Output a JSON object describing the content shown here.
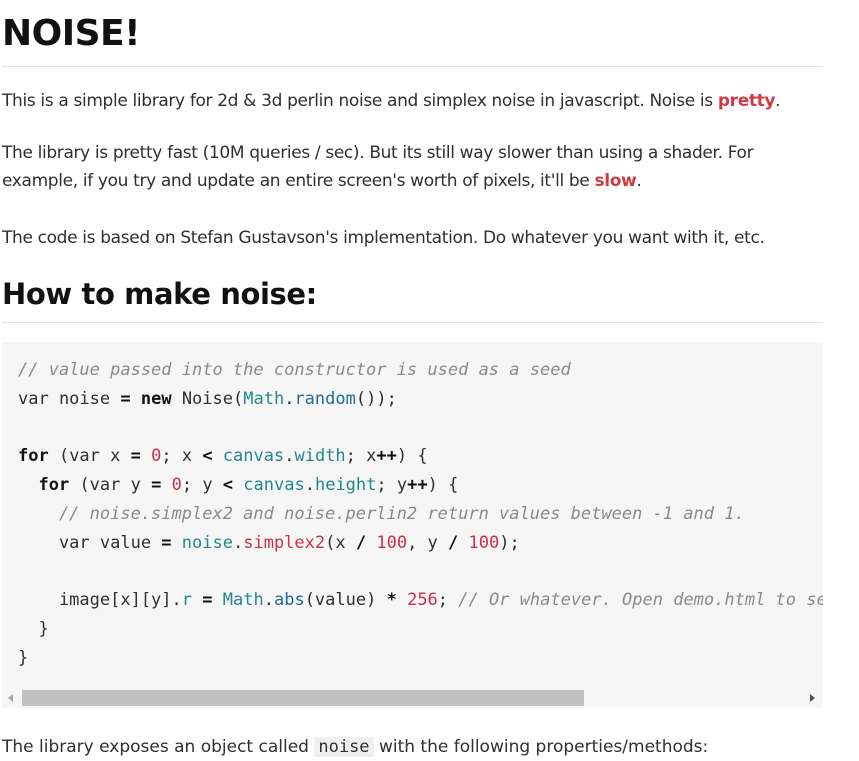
{
  "page": {
    "title": "NOISE!",
    "intro": {
      "text": "This is a simple library for 2d & 3d perlin noise and simplex noise in javascript. Noise is ",
      "highlight": "pretty",
      "end": "."
    },
    "speed": {
      "line1": "The library is pretty fast (10M queries / sec). But its still way slower than using a shader. For",
      "line2": "example, if you try and update an entire screen's worth of pixels, it'll be ",
      "highlight": "slow",
      "end": "."
    },
    "credit": "The code is based on Stefan Gustavson's implementation. Do whatever you want with it, etc.",
    "section_heading": "How to make noise:",
    "bottom_partial": {
      "before": "The library exposes an object called ",
      "code": "noise",
      "after": " with the following properties/methods:"
    }
  },
  "code": {
    "l1": "// value passed into the constructor is used as a seed",
    "l2": {
      "a": "var noise ",
      "eq": "=",
      "b": " ",
      "new": "new",
      "c": " Noise(",
      "math": "Math",
      "dot": ".",
      "random": "random",
      "d": "());"
    },
    "l4": {
      "for": "for",
      "a": " (var x ",
      "eq": "=",
      "b": " ",
      "zero": "0",
      "c": "; x ",
      "lt": "<",
      "d": " ",
      "canvas": "canvas",
      "dot": ".",
      "width": "width",
      "e": "; x",
      "pp": "++",
      "f": ") {"
    },
    "l5": {
      "indent": "  ",
      "for": "for",
      "a": " (var y ",
      "eq": "=",
      "b": " ",
      "zero": "0",
      "c": "; y ",
      "lt": "<",
      "d": " ",
      "canvas": "canvas",
      "dot": ".",
      "height": "height",
      "e": "; y",
      "pp": "++",
      "f": ") {"
    },
    "l6": "    // noise.simplex2 and noise.perlin2 return values between -1 and 1.",
    "l7": {
      "indent": "    var value ",
      "eq": "=",
      "a": " ",
      "noise": "noise",
      "dot": ".",
      "simplex2": "simplex2",
      "b": "(x ",
      "div1": "/",
      "c": " ",
      "n1": "100",
      "d": ", y ",
      "div2": "/",
      "e": " ",
      "n2": "100",
      "f": ");"
    },
    "l9": {
      "indent": "    image[x][y].",
      "r": "r",
      "a": " ",
      "eq": "=",
      "b": " ",
      "math": "Math",
      "dot": ".",
      "abs": "abs",
      "c": "(value) ",
      "mul": "*",
      "d": " ",
      "n": "256",
      "e": "; ",
      "cmt": "// Or whatever. Open demo.html to see it used with canvas."
    },
    "l10": "  }",
    "l11": "}"
  },
  "scrollbar": {
    "position_fraction": 0.0,
    "visible_fraction": 0.72
  },
  "colors": {
    "highlight": "#cf3b45",
    "code_bg": "#f6f6f6",
    "comment": "#8a8a8a",
    "property": "#21888e",
    "function": "#cf2e4a"
  }
}
